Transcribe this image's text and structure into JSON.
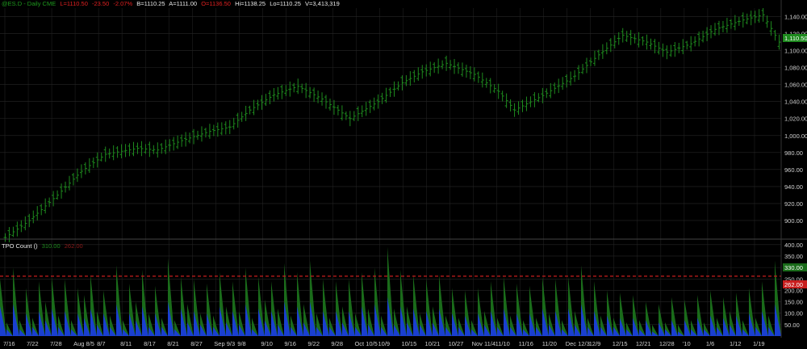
{
  "header": {
    "symbol": "@ES.D - Daily  CME",
    "last": "L=1110.50",
    "change": "-23.50",
    "change_pct": "-2.07%",
    "bid": "B=1110.25",
    "ask": "A=1111.00",
    "open": "O=1136.50",
    "high": "Hi=1138.25",
    "low": "Lo=1110.25",
    "volume": "V=3,413,319"
  },
  "subchart": {
    "title": "TPO Count ()",
    "val1": "310.00",
    "val2": "262.00"
  },
  "price_badge": "1,110.50",
  "tpo_badges": {
    "green": "330.00",
    "red": "262.00"
  },
  "colors": {
    "background": "#000000",
    "up_bar": "#1e8a1e",
    "tpo_green": "#1a6b1a",
    "tpo_blue": "#1a3fd0",
    "ref_line": "#c81e1e",
    "grid": "#262626",
    "axis_text": "#d0d0d0",
    "header_green": "#1e9a1e",
    "header_red": "#e02020",
    "header_white": "#e8e8e8"
  },
  "chart_data": [
    {
      "type": "ohlc",
      "title": "@ES.D - Daily  CME",
      "y_ticks": [
        900,
        920,
        940,
        960,
        980,
        1000,
        1020,
        1040,
        1060,
        1080,
        1100,
        1120,
        1140
      ],
      "y_tick_labels": [
        "900.00",
        "920.00",
        "940.00",
        "960.00",
        "980.00",
        "1,000.00",
        "1,020.00",
        "1,040.00",
        "1,060.00",
        "1,080.00",
        "1,100.00",
        "1,120.00",
        "1,140.00"
      ],
      "ylim": [
        880,
        1150
      ],
      "close_path": [
        [
          0,
          880
        ],
        [
          6,
          900
        ],
        [
          13,
          930
        ],
        [
          19,
          958
        ],
        [
          25,
          978
        ],
        [
          33,
          985
        ],
        [
          38,
          983
        ],
        [
          44,
          994
        ],
        [
          51,
          1005
        ],
        [
          56,
          1010
        ],
        [
          61,
          1030
        ],
        [
          67,
          1048
        ],
        [
          73,
          1058
        ],
        [
          79,
          1043
        ],
        [
          86,
          1020
        ],
        [
          93,
          1040
        ],
        [
          99,
          1062
        ],
        [
          104,
          1075
        ],
        [
          110,
          1085
        ],
        [
          117,
          1072
        ],
        [
          123,
          1052
        ],
        [
          127,
          1030
        ],
        [
          134,
          1047
        ],
        [
          142,
          1070
        ],
        [
          148,
          1095
        ],
        [
          154,
          1118
        ],
        [
          160,
          1110
        ],
        [
          165,
          1098
        ],
        [
          171,
          1108
        ],
        [
          177,
          1125
        ],
        [
          184,
          1136
        ],
        [
          189,
          1142
        ],
        [
          193,
          1110
        ]
      ]
    },
    {
      "type": "bar",
      "title": "TPO Count ()",
      "series": [
        {
          "values": [
            250,
            60,
            300,
            70,
            210,
            80,
            240,
            150,
            260,
            90,
            250,
            70,
            210,
            180,
            270,
            110,
            200,
            90,
            310,
            70,
            230,
            150,
            290,
            100,
            220,
            80,
            340,
            70,
            260,
            140,
            250,
            100,
            230,
            90,
            280,
            130,
            240,
            110,
            300,
            80,
            260,
            160,
            240,
            120,
            320,
            90,
            280,
            140,
            330,
            100,
            250,
            80,
            240,
            130,
            250,
            100,
            280,
            120,
            300,
            90,
            390,
            120,
            290,
            130,
            270,
            100,
            250,
            130,
            270,
            90,
            210,
            80,
            200,
            70,
            210,
            110,
            240,
            80,
            260,
            90,
            230,
            70,
            220,
            80,
            260,
            100,
            250,
            70,
            260,
            110,
            310,
            80,
            240,
            90,
            200,
            80,
            190,
            60,
            180,
            70,
            150,
            50,
            140,
            60,
            170,
            50,
            160,
            70,
            180,
            60,
            200,
            80,
            170,
            110,
            190,
            70,
            210,
            80,
            240,
            90,
            330
          ]
        },
        {
          "values": [
            130,
            30,
            140,
            30,
            100,
            40,
            110,
            70,
            120,
            40,
            110,
            30,
            100,
            80,
            120,
            50,
            100,
            40,
            140,
            30,
            100,
            70,
            130,
            40,
            100,
            40,
            150,
            30,
            120,
            60,
            110,
            50,
            100,
            40,
            130,
            60,
            110,
            50,
            140,
            30,
            120,
            70,
            110,
            50,
            150,
            40,
            130,
            60,
            150,
            40,
            110,
            40,
            110,
            60,
            110,
            40,
            130,
            50,
            140,
            40,
            170,
            50,
            130,
            60,
            120,
            50,
            110,
            60,
            120,
            40,
            100,
            40,
            90,
            30,
            100,
            50,
            110,
            40,
            120,
            40,
            100,
            30,
            100,
            40,
            120,
            50,
            110,
            30,
            120,
            50,
            140,
            40,
            110,
            40,
            90,
            40,
            80,
            30,
            80,
            30,
            70,
            20,
            60,
            30,
            70,
            20,
            70,
            30,
            80,
            30,
            90,
            40,
            80,
            50,
            90,
            30,
            100,
            40,
            110,
            40,
            140
          ]
        }
      ],
      "reference_line": 262,
      "y_ticks": [
        50,
        100,
        150,
        200,
        250,
        300,
        350,
        400
      ],
      "y_tick_labels": [
        "50.00",
        "100.00",
        "150.00",
        "200.00",
        "250.00",
        "300.00",
        "350.00",
        "400.00"
      ],
      "ylim": [
        0,
        410
      ]
    }
  ],
  "x_axis_labels": [
    "7/16",
    "7/22",
    "7/28",
    "Aug 8/5",
    "8/7",
    "8/11",
    "8/17",
    "8/21",
    "8/27",
    "Sep 9/3",
    "9/8",
    "9/10",
    "9/16",
    "9/22",
    "9/28",
    "Oct 10/5",
    "10/9",
    "10/15",
    "10/21",
    "10/27",
    "Nov 11/4",
    "11/10",
    "11/16",
    "11/20",
    "Dec 12/3",
    "12/9",
    "12/15",
    "12/21",
    "12/28",
    "'10",
    "1/6",
    "1/12",
    "1/19"
  ]
}
